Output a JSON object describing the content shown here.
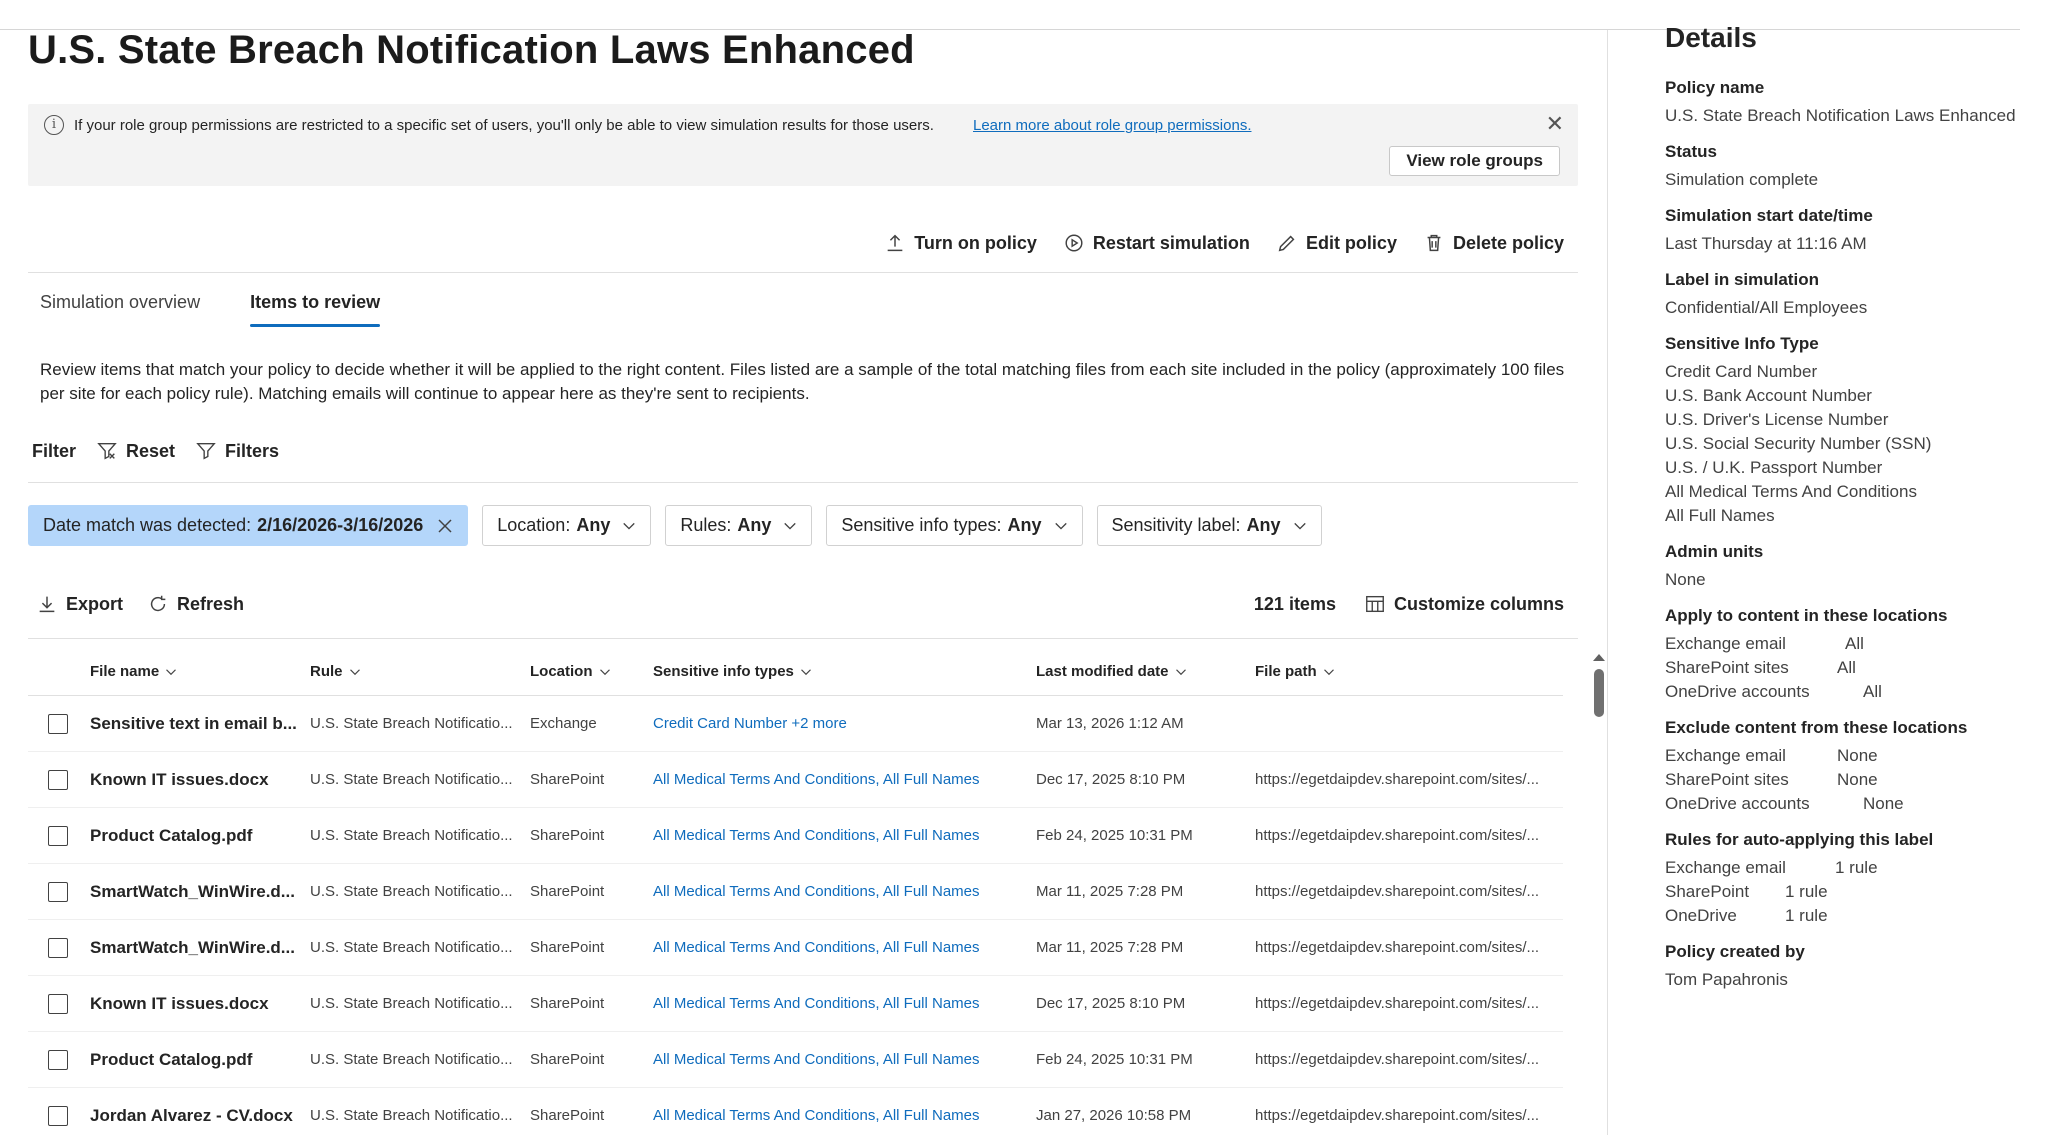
{
  "page": {
    "title": "U.S. State Breach Notification Laws Enhanced"
  },
  "info_bar": {
    "text": "If your role group permissions are restricted to a specific set of users, you'll only be able to view simulation results for those users.",
    "link": "Learn more about role group permissions.",
    "button": "View role groups"
  },
  "actions": [
    "Turn on policy",
    "Restart simulation",
    "Edit policy",
    "Delete policy"
  ],
  "tabs": [
    {
      "label": "Simulation overview",
      "active": false
    },
    {
      "label": "Items to review",
      "active": true
    }
  ],
  "description": "Review items that match your policy to decide whether it will be applied to the right content. Files listed are a sample of the total matching files from each site included in the policy (approximately 100 files per site for each policy rule). Matching emails will continue to appear here as they're sent to recipients.",
  "filter": {
    "label": "Filter",
    "reset": "Reset",
    "filters": "Filters"
  },
  "chips": [
    {
      "label": "Date match was detected:",
      "value": "2/16/2026-3/16/2026",
      "selected": true
    },
    {
      "label": "Location:",
      "value": "Any",
      "selected": false
    },
    {
      "label": "Rules:",
      "value": "Any",
      "selected": false
    },
    {
      "label": "Sensitive info types:",
      "value": "Any",
      "selected": false
    },
    {
      "label": "Sensitivity label:",
      "value": "Any",
      "selected": false
    }
  ],
  "toolbar": {
    "export": "Export",
    "refresh": "Refresh",
    "count": "121 items",
    "customize": "Customize columns"
  },
  "table": {
    "columns": [
      "File name",
      "Rule",
      "Location",
      "Sensitive info types",
      "Last modified date",
      "File path"
    ],
    "rows": [
      [
        "Sensitive text in email b...",
        "U.S. State Breach Notificatio...",
        "Exchange",
        "Credit Card Number +2 more",
        "Mar 13, 2026 1:12 AM",
        ""
      ],
      [
        "Known IT issues.docx",
        "U.S. State Breach Notificatio...",
        "SharePoint",
        "All Medical Terms And Conditions, All Full Names",
        "Dec 17, 2025 8:10 PM",
        "https://egetdaipdev.sharepoint.com/sites/..."
      ],
      [
        "Product Catalog.pdf",
        "U.S. State Breach Notificatio...",
        "SharePoint",
        "All Medical Terms And Conditions, All Full Names",
        "Feb 24, 2025 10:31 PM",
        "https://egetdaipdev.sharepoint.com/sites/..."
      ],
      [
        "SmartWatch_WinWire.d...",
        "U.S. State Breach Notificatio...",
        "SharePoint",
        "All Medical Terms And Conditions, All Full Names",
        "Mar 11, 2025 7:28 PM",
        "https://egetdaipdev.sharepoint.com/sites/..."
      ],
      [
        "SmartWatch_WinWire.d...",
        "U.S. State Breach Notificatio...",
        "SharePoint",
        "All Medical Terms And Conditions, All Full Names",
        "Mar 11, 2025 7:28 PM",
        "https://egetdaipdev.sharepoint.com/sites/..."
      ],
      [
        "Known IT issues.docx",
        "U.S. State Breach Notificatio...",
        "SharePoint",
        "All Medical Terms And Conditions, All Full Names",
        "Dec 17, 2025 8:10 PM",
        "https://egetdaipdev.sharepoint.com/sites/..."
      ],
      [
        "Product Catalog.pdf",
        "U.S. State Breach Notificatio...",
        "SharePoint",
        "All Medical Terms And Conditions, All Full Names",
        "Feb 24, 2025 10:31 PM",
        "https://egetdaipdev.sharepoint.com/sites/..."
      ],
      [
        "Jordan Alvarez - CV.docx",
        "U.S. State Breach Notificatio...",
        "SharePoint",
        "All Medical Terms And Conditions, All Full Names",
        "Jan 27, 2026 10:58 PM",
        "https://egetdaipdev.sharepoint.com/sites/..."
      ]
    ]
  },
  "details": {
    "title": "Details",
    "policy_name_label": "Policy name",
    "policy_name": "U.S. State Breach Notification Laws Enhanced",
    "status_label": "Status",
    "status": "Simulation complete",
    "start_label": "Simulation start date/time",
    "start": "Last Thursday at 11:16 AM",
    "label_label": "Label in simulation",
    "label": "Confidential/All Employees",
    "sit_label": "Sensitive Info Type",
    "sits": [
      "Credit Card Number",
      "U.S. Bank Account Number",
      "U.S. Driver's License Number",
      "U.S. Social Security Number (SSN)",
      "U.S. / U.K. Passport Number",
      "All Medical Terms And Conditions",
      "All Full Names"
    ],
    "admin_label": "Admin units",
    "admin": "None",
    "apply_label": "Apply to content in these locations",
    "apply": [
      {
        "k": "Exchange email",
        "v": "All"
      },
      {
        "k": "SharePoint sites",
        "v": "All"
      },
      {
        "k": "OneDrive accounts",
        "v": "All"
      }
    ],
    "exclude_label": "Exclude content from these locations",
    "exclude": [
      {
        "k": "Exchange email",
        "v": "None"
      },
      {
        "k": "SharePoint sites",
        "v": "None"
      },
      {
        "k": "OneDrive accounts",
        "v": "None"
      }
    ],
    "rules_label": "Rules for auto-applying this label",
    "rules": [
      {
        "k": "Exchange email",
        "v": "1 rule"
      },
      {
        "k": "SharePoint",
        "v": "1 rule"
      },
      {
        "k": "OneDrive",
        "v": "1 rule"
      }
    ],
    "created_label": "Policy created by",
    "created": "Tom Papahronis"
  }
}
